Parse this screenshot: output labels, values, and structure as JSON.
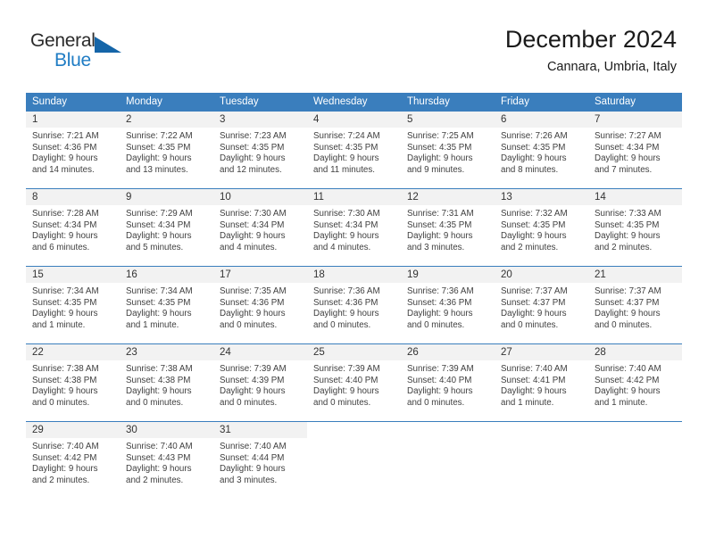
{
  "brand": {
    "name_top": "General",
    "name_bottom": "Blue",
    "triangle_color": "#1565a8",
    "blue_color": "#1f7cc4"
  },
  "header": {
    "title": "December 2024",
    "subtitle": "Cannara, Umbria, Italy"
  },
  "theme": {
    "header_bg": "#3a7ebd",
    "header_text": "#ffffff",
    "daynum_bg": "#f2f2f2",
    "rule_color": "#3a7ebd",
    "body_text": "#404040"
  },
  "weekday_headers": [
    "Sunday",
    "Monday",
    "Tuesday",
    "Wednesday",
    "Thursday",
    "Friday",
    "Saturday"
  ],
  "weeks": [
    [
      {
        "day": "1",
        "sunrise": "Sunrise: 7:21 AM",
        "sunset": "Sunset: 4:36 PM",
        "daylight_line1": "Daylight: 9 hours",
        "daylight_line2": "and 14 minutes."
      },
      {
        "day": "2",
        "sunrise": "Sunrise: 7:22 AM",
        "sunset": "Sunset: 4:35 PM",
        "daylight_line1": "Daylight: 9 hours",
        "daylight_line2": "and 13 minutes."
      },
      {
        "day": "3",
        "sunrise": "Sunrise: 7:23 AM",
        "sunset": "Sunset: 4:35 PM",
        "daylight_line1": "Daylight: 9 hours",
        "daylight_line2": "and 12 minutes."
      },
      {
        "day": "4",
        "sunrise": "Sunrise: 7:24 AM",
        "sunset": "Sunset: 4:35 PM",
        "daylight_line1": "Daylight: 9 hours",
        "daylight_line2": "and 11 minutes."
      },
      {
        "day": "5",
        "sunrise": "Sunrise: 7:25 AM",
        "sunset": "Sunset: 4:35 PM",
        "daylight_line1": "Daylight: 9 hours",
        "daylight_line2": "and 9 minutes."
      },
      {
        "day": "6",
        "sunrise": "Sunrise: 7:26 AM",
        "sunset": "Sunset: 4:35 PM",
        "daylight_line1": "Daylight: 9 hours",
        "daylight_line2": "and 8 minutes."
      },
      {
        "day": "7",
        "sunrise": "Sunrise: 7:27 AM",
        "sunset": "Sunset: 4:34 PM",
        "daylight_line1": "Daylight: 9 hours",
        "daylight_line2": "and 7 minutes."
      }
    ],
    [
      {
        "day": "8",
        "sunrise": "Sunrise: 7:28 AM",
        "sunset": "Sunset: 4:34 PM",
        "daylight_line1": "Daylight: 9 hours",
        "daylight_line2": "and 6 minutes."
      },
      {
        "day": "9",
        "sunrise": "Sunrise: 7:29 AM",
        "sunset": "Sunset: 4:34 PM",
        "daylight_line1": "Daylight: 9 hours",
        "daylight_line2": "and 5 minutes."
      },
      {
        "day": "10",
        "sunrise": "Sunrise: 7:30 AM",
        "sunset": "Sunset: 4:34 PM",
        "daylight_line1": "Daylight: 9 hours",
        "daylight_line2": "and 4 minutes."
      },
      {
        "day": "11",
        "sunrise": "Sunrise: 7:30 AM",
        "sunset": "Sunset: 4:34 PM",
        "daylight_line1": "Daylight: 9 hours",
        "daylight_line2": "and 4 minutes."
      },
      {
        "day": "12",
        "sunrise": "Sunrise: 7:31 AM",
        "sunset": "Sunset: 4:35 PM",
        "daylight_line1": "Daylight: 9 hours",
        "daylight_line2": "and 3 minutes."
      },
      {
        "day": "13",
        "sunrise": "Sunrise: 7:32 AM",
        "sunset": "Sunset: 4:35 PM",
        "daylight_line1": "Daylight: 9 hours",
        "daylight_line2": "and 2 minutes."
      },
      {
        "day": "14",
        "sunrise": "Sunrise: 7:33 AM",
        "sunset": "Sunset: 4:35 PM",
        "daylight_line1": "Daylight: 9 hours",
        "daylight_line2": "and 2 minutes."
      }
    ],
    [
      {
        "day": "15",
        "sunrise": "Sunrise: 7:34 AM",
        "sunset": "Sunset: 4:35 PM",
        "daylight_line1": "Daylight: 9 hours",
        "daylight_line2": "and 1 minute."
      },
      {
        "day": "16",
        "sunrise": "Sunrise: 7:34 AM",
        "sunset": "Sunset: 4:35 PM",
        "daylight_line1": "Daylight: 9 hours",
        "daylight_line2": "and 1 minute."
      },
      {
        "day": "17",
        "sunrise": "Sunrise: 7:35 AM",
        "sunset": "Sunset: 4:36 PM",
        "daylight_line1": "Daylight: 9 hours",
        "daylight_line2": "and 0 minutes."
      },
      {
        "day": "18",
        "sunrise": "Sunrise: 7:36 AM",
        "sunset": "Sunset: 4:36 PM",
        "daylight_line1": "Daylight: 9 hours",
        "daylight_line2": "and 0 minutes."
      },
      {
        "day": "19",
        "sunrise": "Sunrise: 7:36 AM",
        "sunset": "Sunset: 4:36 PM",
        "daylight_line1": "Daylight: 9 hours",
        "daylight_line2": "and 0 minutes."
      },
      {
        "day": "20",
        "sunrise": "Sunrise: 7:37 AM",
        "sunset": "Sunset: 4:37 PM",
        "daylight_line1": "Daylight: 9 hours",
        "daylight_line2": "and 0 minutes."
      },
      {
        "day": "21",
        "sunrise": "Sunrise: 7:37 AM",
        "sunset": "Sunset: 4:37 PM",
        "daylight_line1": "Daylight: 9 hours",
        "daylight_line2": "and 0 minutes."
      }
    ],
    [
      {
        "day": "22",
        "sunrise": "Sunrise: 7:38 AM",
        "sunset": "Sunset: 4:38 PM",
        "daylight_line1": "Daylight: 9 hours",
        "daylight_line2": "and 0 minutes."
      },
      {
        "day": "23",
        "sunrise": "Sunrise: 7:38 AM",
        "sunset": "Sunset: 4:38 PM",
        "daylight_line1": "Daylight: 9 hours",
        "daylight_line2": "and 0 minutes."
      },
      {
        "day": "24",
        "sunrise": "Sunrise: 7:39 AM",
        "sunset": "Sunset: 4:39 PM",
        "daylight_line1": "Daylight: 9 hours",
        "daylight_line2": "and 0 minutes."
      },
      {
        "day": "25",
        "sunrise": "Sunrise: 7:39 AM",
        "sunset": "Sunset: 4:40 PM",
        "daylight_line1": "Daylight: 9 hours",
        "daylight_line2": "and 0 minutes."
      },
      {
        "day": "26",
        "sunrise": "Sunrise: 7:39 AM",
        "sunset": "Sunset: 4:40 PM",
        "daylight_line1": "Daylight: 9 hours",
        "daylight_line2": "and 0 minutes."
      },
      {
        "day": "27",
        "sunrise": "Sunrise: 7:40 AM",
        "sunset": "Sunset: 4:41 PM",
        "daylight_line1": "Daylight: 9 hours",
        "daylight_line2": "and 1 minute."
      },
      {
        "day": "28",
        "sunrise": "Sunrise: 7:40 AM",
        "sunset": "Sunset: 4:42 PM",
        "daylight_line1": "Daylight: 9 hours",
        "daylight_line2": "and 1 minute."
      }
    ],
    [
      {
        "day": "29",
        "sunrise": "Sunrise: 7:40 AM",
        "sunset": "Sunset: 4:42 PM",
        "daylight_line1": "Daylight: 9 hours",
        "daylight_line2": "and 2 minutes."
      },
      {
        "day": "30",
        "sunrise": "Sunrise: 7:40 AM",
        "sunset": "Sunset: 4:43 PM",
        "daylight_line1": "Daylight: 9 hours",
        "daylight_line2": "and 2 minutes."
      },
      {
        "day": "31",
        "sunrise": "Sunrise: 7:40 AM",
        "sunset": "Sunset: 4:44 PM",
        "daylight_line1": "Daylight: 9 hours",
        "daylight_line2": "and 3 minutes."
      },
      {
        "day": "",
        "sunrise": "",
        "sunset": "",
        "daylight_line1": "",
        "daylight_line2": ""
      },
      {
        "day": "",
        "sunrise": "",
        "sunset": "",
        "daylight_line1": "",
        "daylight_line2": ""
      },
      {
        "day": "",
        "sunrise": "",
        "sunset": "",
        "daylight_line1": "",
        "daylight_line2": ""
      },
      {
        "day": "",
        "sunrise": "",
        "sunset": "",
        "daylight_line1": "",
        "daylight_line2": ""
      }
    ]
  ]
}
